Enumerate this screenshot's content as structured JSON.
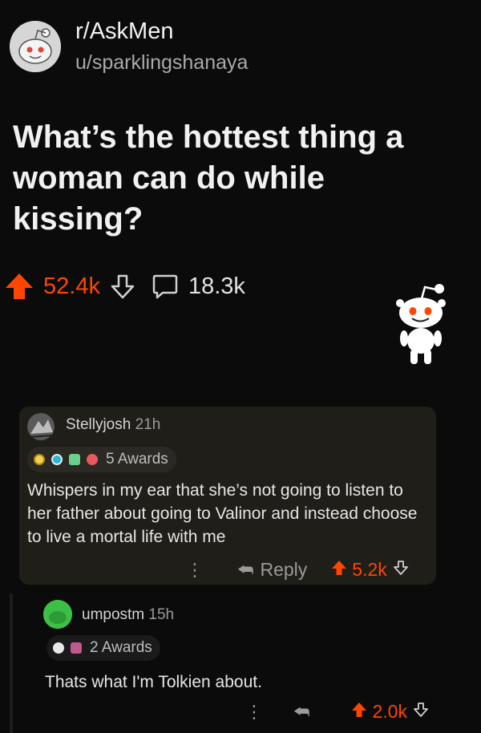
{
  "post": {
    "subreddit": "r/AskMen",
    "username": "u/sparklingshanaya",
    "title": "What’s the hottest thing a woman can do while kissing?",
    "score": "52.4k",
    "comment_count": "18.3k"
  },
  "comments": [
    {
      "author": "Stellyjosh",
      "time": "21h",
      "awards": "5 Awards",
      "body": "Whispers in my ear that she’s not going to listen to her father about going to Valinor and instead choose to live a mortal life with me",
      "more_label": "⋮",
      "reply_label": "Reply",
      "score": "5.2k"
    },
    {
      "author": "umpostm",
      "time": "15h",
      "awards": "2 Awards",
      "body": "Thats what I'm Tolkien about.",
      "more_label": "⋮",
      "score": "2.0k"
    }
  ],
  "colors": {
    "upvote": "#ff4500",
    "background": "#0b0b0b",
    "highlight_comment": "#1f1e18"
  }
}
